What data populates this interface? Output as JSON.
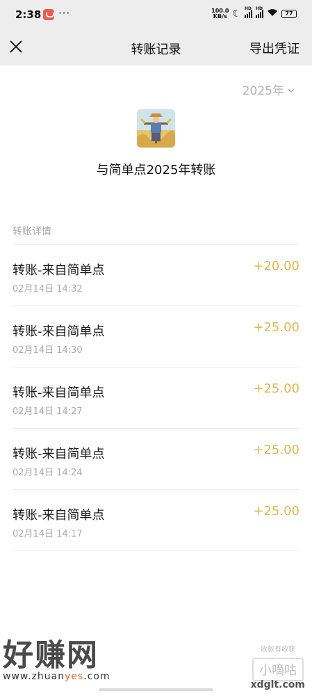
{
  "status_bar": {
    "time": "2:38",
    "more": "···",
    "net_speed_top": "100.0",
    "net_speed_bottom": "KB/s",
    "hd1": "HD",
    "hd2": "HD",
    "battery": "77"
  },
  "nav": {
    "title": "转账记录",
    "export_label": "导出凭证"
  },
  "year_picker": {
    "value": "2025年"
  },
  "summary": {
    "title": "与简单点2025年转账"
  },
  "section": {
    "label": "转账详情"
  },
  "transfers": [
    {
      "title": "转账-来自简单点",
      "time": "02月14日 14:32",
      "amount": "+20.00"
    },
    {
      "title": "转账-来自简单点",
      "time": "02月14日 14:30",
      "amount": "+25.00"
    },
    {
      "title": "转账-来自简单点",
      "time": "02月14日 14:27",
      "amount": "+25.00"
    },
    {
      "title": "转账-来自简单点",
      "time": "02月14日 14:24",
      "amount": "+25.00"
    },
    {
      "title": "转账-来自简单点",
      "time": "02月14日 14:17",
      "amount": "+25.00"
    }
  ],
  "watermark": {
    "logo": "好赚网",
    "url_a": "www.zhuan",
    "url_b": "yes",
    "url_c": ".com",
    "small": "收款有收获",
    "box": "小嘀咕",
    "site": "xdglt.com"
  },
  "colors": {
    "amount": "#e1b84a",
    "bar_bg": "#ededed"
  }
}
